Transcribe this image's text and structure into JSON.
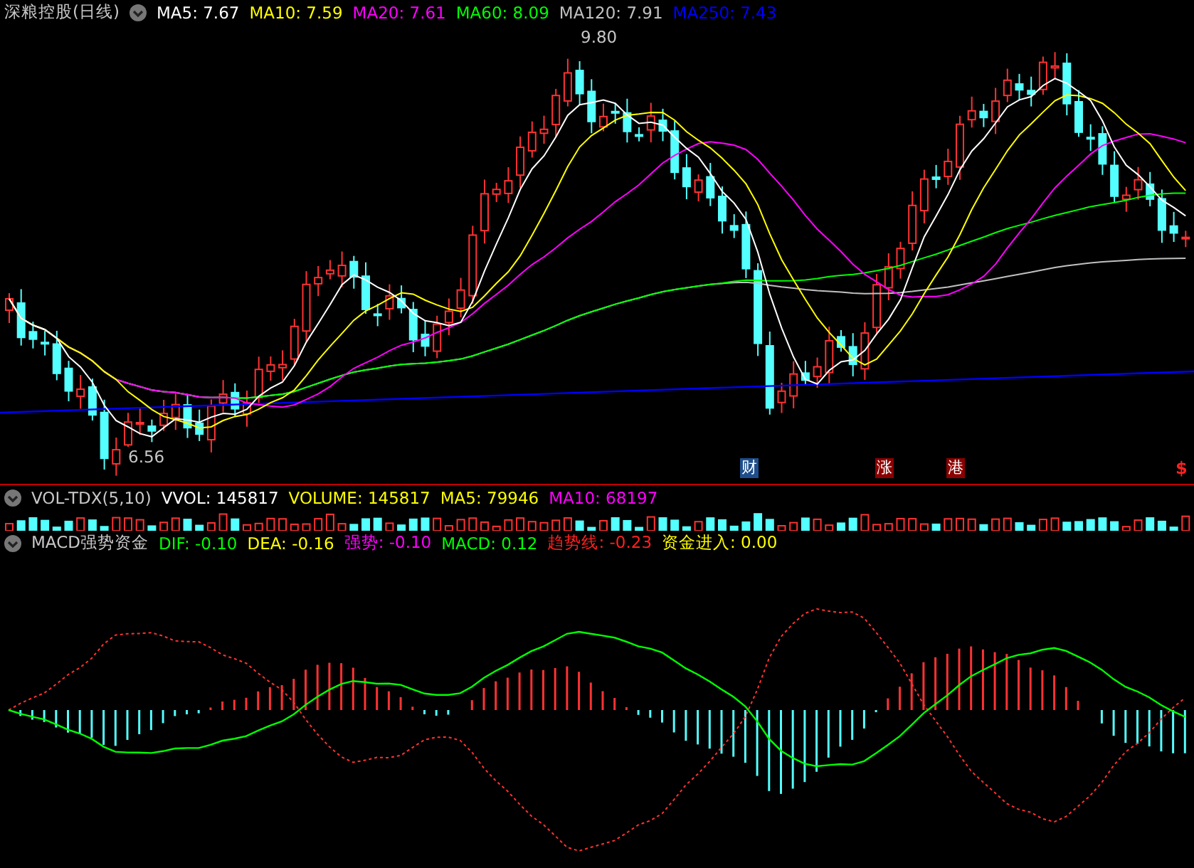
{
  "main": {
    "title": "深粮控股(日线)",
    "indicators": [
      {
        "label": "MA5: 7.67",
        "color": "#ffffff"
      },
      {
        "label": "MA10: 7.59",
        "color": "#ffff00"
      },
      {
        "label": "MA20: 7.61",
        "color": "#ff00ff"
      },
      {
        "label": "MA60: 8.09",
        "color": "#00ff00"
      },
      {
        "label": "MA120: 7.91",
        "color": "#c0c0c0"
      },
      {
        "label": "MA250: 7.43",
        "color": "#0000ff"
      }
    ],
    "high_label": "9.80",
    "low_label": "6.56",
    "markers": [
      {
        "text": "财",
        "kind": "badge",
        "color": "#1f4e8c"
      },
      {
        "text": "涨",
        "kind": "badge",
        "color": "#8b0000"
      },
      {
        "text": "港",
        "kind": "badge",
        "color": "#8b0000"
      },
      {
        "text": "$",
        "kind": "symbol",
        "color": "#ff2020"
      }
    ]
  },
  "volume": {
    "title": "VOL-TDX(5,10)",
    "indicators": [
      {
        "label": "VVOL: 145817",
        "color": "#ffffff"
      },
      {
        "label": "VOLUME: 145817",
        "color": "#ffff00"
      },
      {
        "label": "MA5: 79946",
        "color": "#ffff00"
      },
      {
        "label": "MA10: 68197",
        "color": "#ff00ff"
      }
    ]
  },
  "macd": {
    "title": "MACD强势资金",
    "indicators": [
      {
        "label": "DIF: -0.10",
        "color": "#00ff00"
      },
      {
        "label": "DEA: -0.16",
        "color": "#ffff00"
      },
      {
        "label": "强势: -0.10",
        "color": "#ff00ff"
      },
      {
        "label": "MACD: 0.12",
        "color": "#00ff00"
      },
      {
        "label": "趋势线: -0.23",
        "color": "#ff2020"
      },
      {
        "label": "资金进入: 0.00",
        "color": "#ffff00"
      }
    ]
  }
}
